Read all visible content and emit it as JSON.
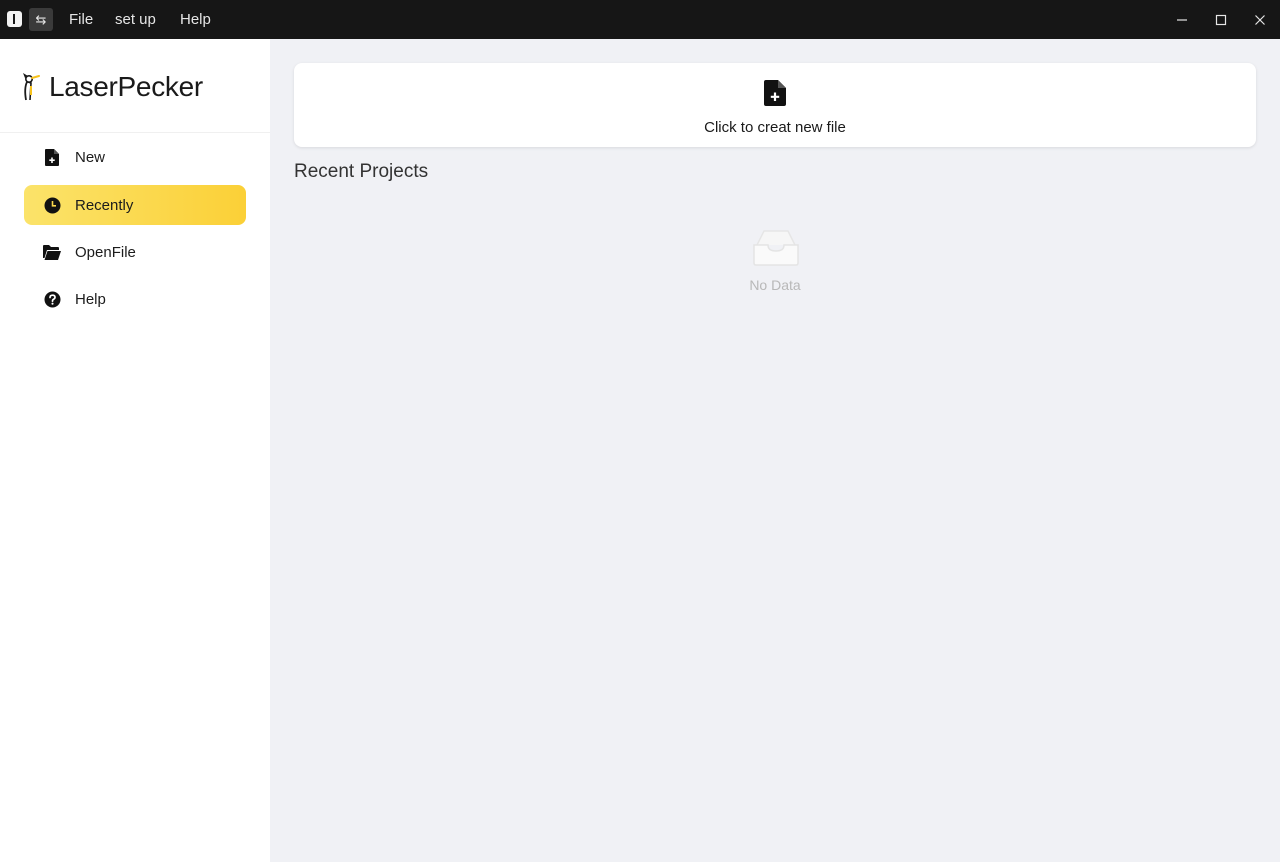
{
  "titlebar": {
    "menus": [
      {
        "label": "File"
      },
      {
        "label": "set up"
      },
      {
        "label": "Help"
      }
    ],
    "switch_glyph": "⇆",
    "window_controls": [
      "minimize-icon",
      "maximize-icon",
      "close-icon"
    ]
  },
  "sidebar": {
    "logo_text": "LaserPecker",
    "items": [
      {
        "label": "New",
        "icon": "new-file-icon",
        "active": false
      },
      {
        "label": "Recently",
        "icon": "clock-icon",
        "active": true
      },
      {
        "label": "OpenFile",
        "icon": "folder-open-icon",
        "active": false
      },
      {
        "label": "Help",
        "icon": "help-circle-icon",
        "active": false
      }
    ]
  },
  "main": {
    "new_card_label": "Click to creat new file",
    "section_title": "Recent Projects",
    "empty_text": "No Data"
  },
  "colors": {
    "titlebar_bg": "#161616",
    "accent_yellow": "#fbd037",
    "main_bg": "#f0f1f5"
  }
}
